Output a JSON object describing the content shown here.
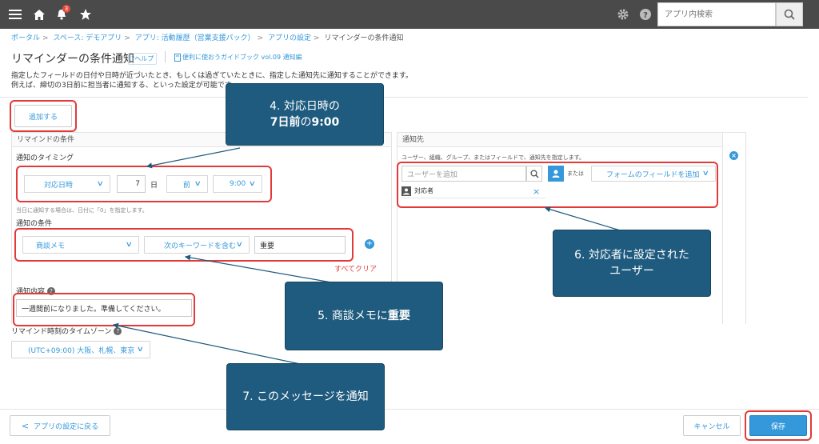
{
  "topbar": {
    "search_placeholder": "アプリ内検索",
    "notification_count": "3",
    "icons": [
      "menu-icon",
      "home-icon",
      "bell-icon",
      "star-icon",
      "gear-icon",
      "help-icon",
      "search-icon"
    ]
  },
  "breadcrumb": {
    "items": [
      "ポータル",
      "スペース: デモアプリ",
      "アプリ: 活動履歴（営業支援パック）",
      "アプリの設定"
    ],
    "current": "リマインダーの条件通知"
  },
  "header": {
    "title": "リマインダーの条件通知",
    "help": "?ヘルプ",
    "guide": "便利に使おうガイドブック vol.09 通知編",
    "desc1": "指定したフィールドの日付や日時が近づいたとき、もしくは過ぎていたときに、指定した通知先に通知することができます。",
    "desc2": "例えば、締切の3日前に担当者に通知する、といった設定が可能です。"
  },
  "add_button": "追加する",
  "left_panel": {
    "head": "リマインドの条件",
    "timing_label": "通知のタイミング",
    "field": "対応日時",
    "days": "7",
    "day_unit": "日",
    "before_after": "前",
    "time": "9:00",
    "hint": "当日に通知する場合は、日付に「0」を指定します。",
    "condition_label": "通知の条件",
    "cond_field": "商談メモ",
    "cond_op": "次のキーワードを含む",
    "cond_value": "重要",
    "clear_all": "すべてクリア",
    "content_label": "通知内容",
    "content_value": "一週間前になりました。準備してください。"
  },
  "right_panel": {
    "head": "通知先",
    "desc": "ユーザー、組織、グループ、またはフィールドで、通知先を指定します。",
    "user_placeholder": "ユーザーを追加",
    "or": "または",
    "field_add": "フォームのフィールドを追加",
    "entry": "対応者"
  },
  "timezone": {
    "label": "リマインド時刻のタイムゾーン",
    "value": "(UTC+09:00) 大阪、札幌、東京"
  },
  "footer": {
    "back": "アプリの設定に戻る",
    "cancel": "キャンセル",
    "save": "保存"
  },
  "callouts": {
    "c4_line1": "4. 対応日時の",
    "c4_line2a": "7日前",
    "c4_line2b": "の",
    "c4_line2c": "9:00",
    "c5_a": "5. 商談メモに",
    "c5_b": "重要",
    "c6_line1": "6. 対応者に設定された",
    "c6_line2": "ユーザー",
    "c7": "7. このメッセージを通知"
  },
  "colors": {
    "accent": "#3498db",
    "topbar": "#4a4a4a",
    "callout": "#1f5b7e",
    "highlight": "#e23a3a",
    "save": "#3498db"
  }
}
